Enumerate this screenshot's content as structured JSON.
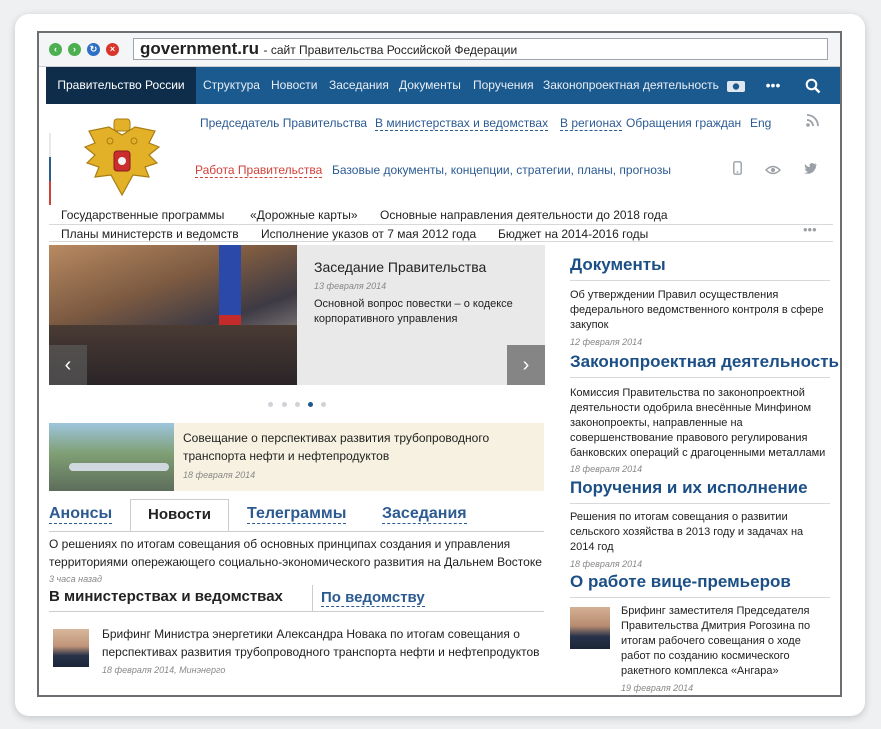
{
  "browser": {
    "domain": "government.ru",
    "title": "- сайт Правительства Российской Федерации"
  },
  "topnav": {
    "home": "Правительство России",
    "items": [
      "Структура",
      "Новости",
      "Заседания",
      "Документы",
      "Поручения",
      "Законопроектная деятельность"
    ]
  },
  "subnav": {
    "row1": [
      "Председатель Правительства",
      "В министерствах и ведомствах",
      "В регионах",
      "Обращения граждан",
      "Eng"
    ],
    "row2_active": "Работа Правительства",
    "row2": "Базовые документы, концепции, стратегии, планы, прогнозы",
    "row3": [
      "Государственные программы",
      "«Дорожные карты»",
      "Основные направления деятельности до 2018 года"
    ],
    "row4": [
      "Планы министерств и ведомств",
      "Исполнение указов от 7 мая 2012 года",
      "Бюджет на 2014-2016 годы"
    ],
    "more": "•••"
  },
  "slider": {
    "title": "Заседание Правительства",
    "date": "13 февраля 2014",
    "text": "Основной вопрос повестки – о кодексе корпоративного управления"
  },
  "feature": {
    "text": "Совещание о перспективах развития трубопроводного транспорта нефти и нефтепродуктов",
    "date": "18 февраля 2014"
  },
  "tabs": {
    "items": [
      "Анонсы",
      "Новости",
      "Телеграммы",
      "Заседания"
    ],
    "active": "Новости"
  },
  "news": {
    "text": "О решениях по итогам совещания об основных принципах создания и управления территориями опережающего социально-экономического развития на Дальнем Востоке",
    "time": "3 часа назад"
  },
  "ministries": {
    "heading": "В министерствах и ведомствах",
    "tab": "По ведомству",
    "item": "Брифинг Министра энергетики Александра Новака по итогам совещания о перспективах развития трубопроводного транспорта нефти и нефтепродуктов",
    "date": "18 февраля 2014, Минэнерго"
  },
  "right": {
    "docs_title": "Документы",
    "docs_text": "Об утверждении Правил осуществления федерального ведомственного контроля в сфере закупок",
    "docs_date": "12 февраля 2014",
    "law_title": "Законопроектная деятельность",
    "law_text": "Комиссия Правительства по законопроектной деятельности одобрила внесённые Минфином законопроекты, направленные на совершенствование правового регулирования банковских операций с драгоценными металлами",
    "law_date": "18 февраля 2014",
    "orders_title": "Поручения и их исполнение",
    "orders_text": "Решения по итогам совещания о развитии сельского хозяйства в 2013 году и задачах на 2014 год",
    "orders_date": "18 февраля 2014",
    "vice_title": "О работе вице-премьеров",
    "vice_text": "Брифинг заместителя Председателя Правительства Дмитрия Рогозина по итогам рабочего совещания о ходе работ по созданию космического ракетного комплекса «Ангара»",
    "vice_date": "19 февраля 2014"
  }
}
